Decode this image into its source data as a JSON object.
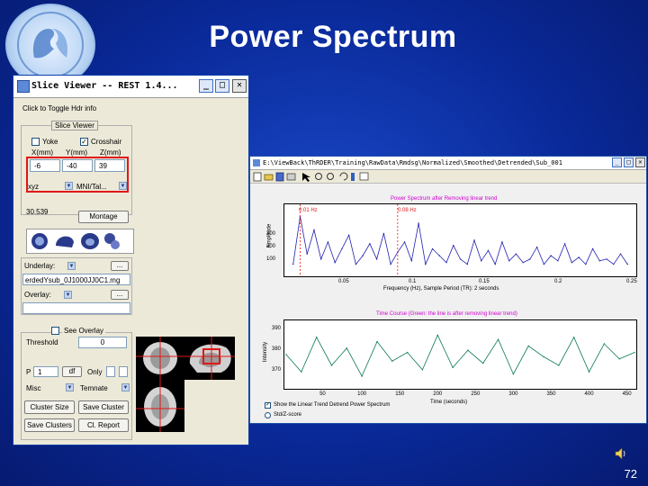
{
  "slide": {
    "title": "Power Spectrum",
    "page_number": "72"
  },
  "colors": {
    "highlight": "#e01818",
    "spectrum_line": "#2020b0",
    "timecourse_line": "#0a7a50",
    "plot_title": "#d000d0"
  },
  "slice_viewer": {
    "window_title": "Slice Viewer -- REST 1.4...",
    "title_buttons": {
      "minimize": "_",
      "maximize": "□",
      "close": "✕"
    },
    "click_hint": "Click to Toggle Hdr info",
    "group_label": "Slice Viewer",
    "yoke_label": "Yoke",
    "crosshair_label": "Crosshair",
    "coord_headers": [
      "X(mm)",
      "Y(mm)",
      "Z(mm)"
    ],
    "coords": {
      "x": "-6",
      "y": "-40",
      "z": "39"
    },
    "xyz_select": "xyz",
    "template_select": "MNI/Tal...",
    "scale_value": "30.539",
    "montage_button": "Montage",
    "view_icons": [
      "brain-top-icon",
      "brain-sagittal-icon",
      "brain-coronal-icon",
      "brain-3d-icon"
    ],
    "underlay_label": "Underlay:",
    "underlay_path": "erdedYsub_0J1000JJ0C1.mg",
    "browse_label": "...",
    "overlay_label": "Overlay:",
    "see_overlay_label": "See Overlay",
    "threshold_label": "Threshold",
    "threshold_value": "0",
    "p_label": "P",
    "p_value": "1",
    "df_label": "df",
    "only_label": "Only",
    "misc_select": "Misc",
    "template_button": "Temnate",
    "cluster_size_button": "Cluster Size",
    "save_cluster_button": "Save Cluster",
    "save_clusters_button": "Save Clusters",
    "cl_report_button": "Cl. Report"
  },
  "power_window": {
    "path": "E:\\ViewBack\\ThRDER\\Training\\RawData\\Rmdsg\\Normalized\\Smoothed\\Detrended\\Sub_001",
    "spectrum_title": "Power Spectrum after Removing linear trend",
    "cursor_labels": [
      "0.01 Hz",
      "0.08 Hz"
    ],
    "spectrum_ylabel": "Amplitude",
    "spectrum_xlabel": "Frequency (Hz), Sample Period (TR): 2 seconds",
    "spectrum_yticks": [
      "300",
      "200",
      "100"
    ],
    "spectrum_xticks": [
      "0.05",
      "0.1",
      "0.15",
      "0.2",
      "0.25"
    ],
    "timecourse_title": "Time Course (Green: the line is after removing linear trend)",
    "timecourse_ylabel": "Intensity",
    "timecourse_xlabel": "Time (seconds)",
    "timecourse_yticks": [
      "390",
      "380",
      "370"
    ],
    "timecourse_xticks": [
      "50",
      "100",
      "150",
      "200",
      "250",
      "300",
      "350",
      "400",
      "450"
    ],
    "checkbox1_label": "Show the Linear Trend Detrend Power Spectrum",
    "checkbox2_label": "Std/Z-score"
  },
  "chart_data": [
    {
      "type": "line",
      "title": "Power Spectrum after Removing linear trend",
      "xlabel": "Frequency (Hz), Sample Period (TR): 2 seconds",
      "ylabel": "Amplitude",
      "xlim": [
        0,
        0.25
      ],
      "ylim": [
        0,
        400
      ],
      "x": [
        0.005,
        0.01,
        0.015,
        0.02,
        0.025,
        0.03,
        0.035,
        0.04,
        0.045,
        0.05,
        0.055,
        0.06,
        0.065,
        0.07,
        0.075,
        0.08,
        0.085,
        0.09,
        0.095,
        0.1,
        0.105,
        0.11,
        0.115,
        0.12,
        0.125,
        0.13,
        0.135,
        0.14,
        0.145,
        0.15,
        0.155,
        0.16,
        0.165,
        0.17,
        0.175,
        0.18,
        0.185,
        0.19,
        0.195,
        0.2,
        0.205,
        0.21,
        0.215,
        0.22,
        0.225,
        0.23,
        0.235,
        0.24,
        0.245
      ],
      "series": [
        {
          "values": [
            60,
            340,
            120,
            260,
            90,
            190,
            70,
            150,
            230,
            60,
            110,
            180,
            90,
            240,
            60,
            130,
            190,
            80,
            300,
            60,
            150,
            110,
            70,
            170,
            90,
            60,
            200,
            80,
            140,
            60,
            190,
            80,
            120,
            70,
            90,
            160,
            60,
            110,
            80,
            180,
            70,
            100,
            60,
            150,
            80,
            90,
            60,
            120,
            60
          ]
        }
      ]
    },
    {
      "type": "line",
      "title": "Time Course (Green: the line is after removing linear trend)",
      "xlabel": "Time (seconds)",
      "ylabel": "Intensity",
      "xlim": [
        0,
        460
      ],
      "ylim": [
        365,
        395
      ],
      "x": [
        0,
        20,
        40,
        60,
        80,
        100,
        120,
        140,
        160,
        180,
        200,
        220,
        240,
        260,
        280,
        300,
        320,
        340,
        360,
        380,
        400,
        420,
        440,
        460
      ],
      "series": [
        {
          "values": [
            380,
            372,
            388,
            375,
            383,
            370,
            386,
            377,
            381,
            373,
            389,
            374,
            382,
            376,
            387,
            371,
            384,
            379,
            375,
            388,
            372,
            385,
            378,
            381
          ]
        }
      ]
    }
  ]
}
